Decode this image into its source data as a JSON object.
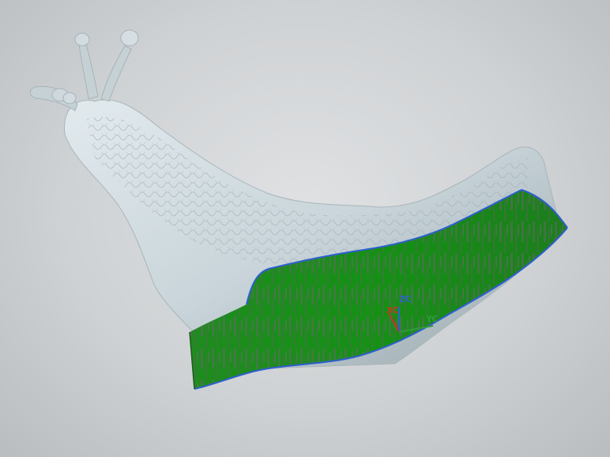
{
  "view": {
    "background_color": "#d3d5d7",
    "model_color": "#c8d3d8",
    "surface_color": "#1a8a1a",
    "surface_edge_color": "#2d5fd0"
  },
  "triad": {
    "xc_label": "XC",
    "yc_label": "YC",
    "zc_label": "ZC",
    "xc_color": "#c03a2b",
    "yc_color": "#2f9a3a",
    "zc_color": "#2a64c8"
  }
}
